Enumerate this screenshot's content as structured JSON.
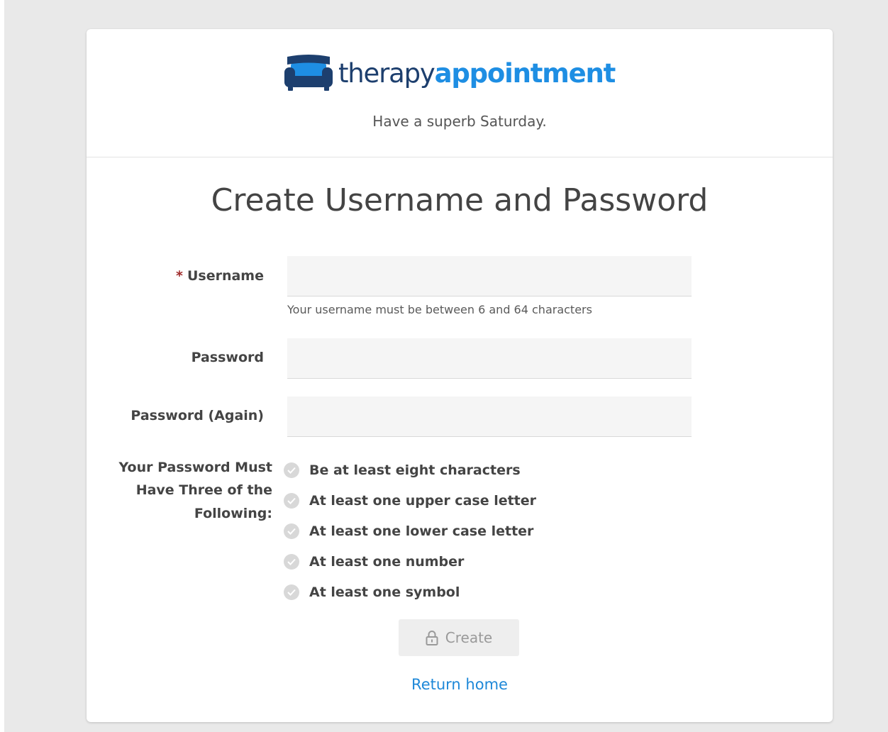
{
  "brand": {
    "name_part1": "therapy",
    "name_part2": "appointment",
    "logo_icon": "couch-icon",
    "colors": {
      "primary_dark": "#1d3f6e",
      "primary_blue": "#1e8ee3",
      "link": "#1e88d8",
      "required_star": "#a02a2a"
    }
  },
  "header": {
    "greeting": "Have a superb Saturday."
  },
  "page": {
    "title": "Create Username and Password"
  },
  "form": {
    "username": {
      "required_mark": "*",
      "label": "Username",
      "value": "",
      "placeholder": "",
      "help": "Your username must be between 6 and 64 characters"
    },
    "password": {
      "label": "Password",
      "value": "",
      "placeholder": ""
    },
    "password_again": {
      "label": "Password (Again)",
      "value": "",
      "placeholder": ""
    },
    "requirements": {
      "label_line1": "Your Password Must",
      "label_line2": "Have Three of the",
      "label_line3": "Following:",
      "items": [
        {
          "text": "Be at least eight characters",
          "icon": "check-circle-icon",
          "met": false
        },
        {
          "text": "At least one upper case letter",
          "icon": "check-circle-icon",
          "met": false
        },
        {
          "text": "At least one lower case letter",
          "icon": "check-circle-icon",
          "met": false
        },
        {
          "text": "At least one number",
          "icon": "check-circle-icon",
          "met": false
        },
        {
          "text": "At least one symbol",
          "icon": "check-circle-icon",
          "met": false
        }
      ]
    },
    "submit": {
      "label": "Create",
      "icon": "lock-icon",
      "disabled": true
    }
  },
  "footer": {
    "return_home": "Return home"
  }
}
